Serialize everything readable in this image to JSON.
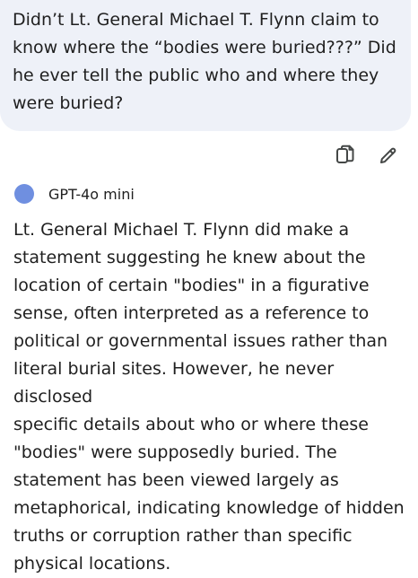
{
  "user_message": {
    "text": "Didn’t Lt. General Michael T. Flynn claim to\nknow where the “bodies were buried???” Did\nhe ever tell the public who and where they\nwere buried?"
  },
  "message_actions": {
    "copy_icon": "copy-icon",
    "edit_icon": "edit-pencil-icon"
  },
  "model": {
    "name": "GPT-4o mini",
    "avatar_color": "#6f8fe0"
  },
  "response": {
    "text": "Lt. General Michael T. Flynn did make a\nstatement suggesting he knew about the\nlocation of certain \"bodies\" in a figurative\nsense, often interpreted as a reference to\npolitical or governmental issues rather than\nliteral burial sites. However, he never disclosed\nspecific details about who or where these\n\"bodies\" were supposedly buried. The\nstatement has been viewed largely as\nmetaphorical, indicating knowledge of hidden\ntruths or corruption rather than specific\nphysical locations."
  }
}
